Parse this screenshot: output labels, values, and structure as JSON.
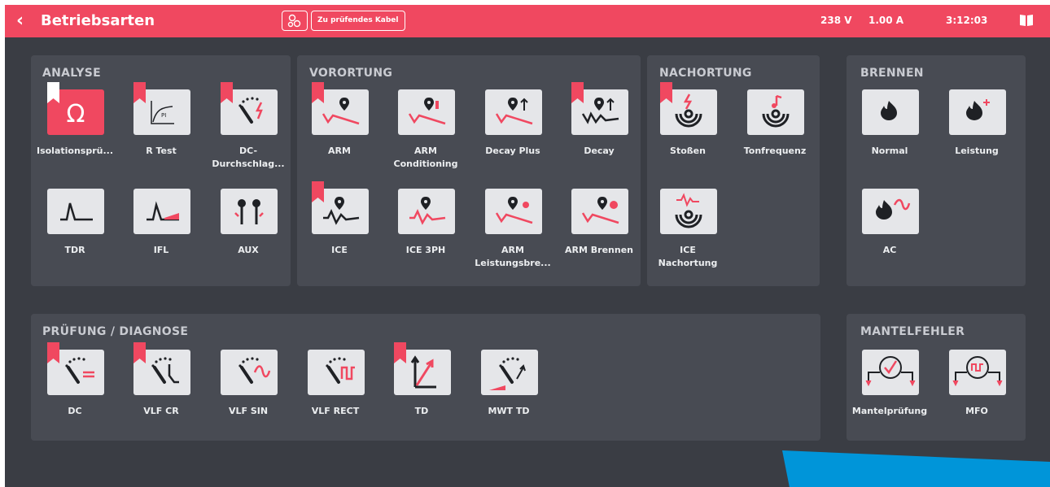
{
  "header": {
    "back_icon": "chevron-left-icon",
    "title": "Betriebsarten",
    "cable_icon": "cable-icon",
    "cable_label": "Zu prüfendes Kabel",
    "voltage": "238 V",
    "current": "1.00 A",
    "time": "3:12:03",
    "book_icon": "book-icon"
  },
  "colors": {
    "accent": "#f04860",
    "background": "#3a3d44",
    "panel": "#484b53",
    "tile": "#e5e6e9",
    "blue_corner": "#0095d9"
  },
  "sections": {
    "analyse": {
      "title": "ANALYSE",
      "tiles": [
        {
          "label": "Isolationsprü...",
          "icon": "omega-icon",
          "flag": true,
          "active": true
        },
        {
          "label": "R Test",
          "icon": "pi-curve-icon",
          "flag": true
        },
        {
          "label": "DC-\nDurchschlag...",
          "icon": "gauge-lightning-icon",
          "flag": true
        },
        {
          "label": "TDR",
          "icon": "tdr-pulse-icon"
        },
        {
          "label": "IFL",
          "icon": "ifl-pulse-icon"
        },
        {
          "label": "AUX",
          "icon": "aux-connectors-icon"
        }
      ]
    },
    "vorortung": {
      "title": "VORORTUNG",
      "tiles": [
        {
          "label": "ARM",
          "icon": "arm-location-icon",
          "flag": true
        },
        {
          "label": "ARM\nConditioning",
          "icon": "arm-conditioning-icon"
        },
        {
          "label": "Decay Plus",
          "icon": "decay-plus-icon"
        },
        {
          "label": "Decay",
          "icon": "decay-icon",
          "flag": true
        },
        {
          "label": "ICE",
          "icon": "ice-icon",
          "flag": true
        },
        {
          "label": "ICE 3PH",
          "icon": "ice-3ph-icon"
        },
        {
          "label": "ARM\nLeistungsbre...",
          "icon": "arm-power-burn-icon"
        },
        {
          "label": "ARM Brennen",
          "icon": "arm-burn-icon"
        }
      ]
    },
    "nachortung": {
      "title": "NACHORTUNG",
      "tiles": [
        {
          "label": "Stoßen",
          "icon": "surge-target-icon",
          "flag": true
        },
        {
          "label": "Tonfrequenz",
          "icon": "audio-target-icon"
        },
        {
          "label": "ICE\nNachortung",
          "icon": "ice-target-icon"
        }
      ]
    },
    "brennen": {
      "title": "BRENNEN",
      "tiles": [
        {
          "label": "Normal",
          "icon": "flame-icon"
        },
        {
          "label": "Leistung",
          "icon": "flame-plus-icon"
        },
        {
          "label": "AC",
          "icon": "flame-wave-icon"
        }
      ]
    },
    "pruefung": {
      "title": "PRÜFUNG / DIAGNOSE",
      "tiles": [
        {
          "label": "DC",
          "icon": "gauge-dc-icon",
          "flag": true
        },
        {
          "label": "VLF CR",
          "icon": "gauge-vlf-cr-icon",
          "flag": true
        },
        {
          "label": "VLF SIN",
          "icon": "gauge-vlf-sin-icon"
        },
        {
          "label": "VLF RECT",
          "icon": "gauge-vlf-rect-icon"
        },
        {
          "label": "TD",
          "icon": "td-arrows-icon",
          "flag": true
        },
        {
          "label": "MWT TD",
          "icon": "gauge-mwt-td-icon"
        }
      ]
    },
    "mantelfehler": {
      "title": "MANTELFEHLER",
      "tiles": [
        {
          "label": "Mantelprüfung",
          "icon": "sheath-test-icon"
        },
        {
          "label": "MFO",
          "icon": "sheath-mfo-icon"
        }
      ]
    }
  }
}
